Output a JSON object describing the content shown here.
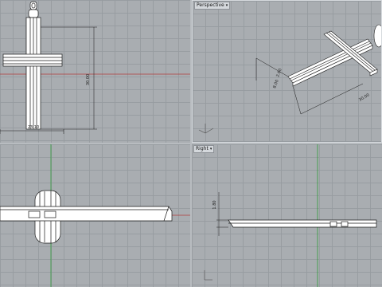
{
  "viewports": {
    "top": {
      "label": ""
    },
    "perspective": {
      "label": "Perspective",
      "caret": "▾"
    },
    "front": {
      "label": ""
    },
    "right": {
      "label": "Right",
      "caret": "▾"
    }
  },
  "dimensions": {
    "top_height": "30.00",
    "top_width": "23.10",
    "persp_a": "2.60",
    "persp_b": "8.00",
    "persp_c": "30.00",
    "right_thickness": "1.80"
  },
  "colors": {
    "viewport_bg": "#a9adb1",
    "grid": "#969ba0",
    "x_axis": "#b03a3a",
    "y_axis": "#2f9a3a",
    "model": "#ffffff",
    "outline": "#1a1a1a"
  }
}
